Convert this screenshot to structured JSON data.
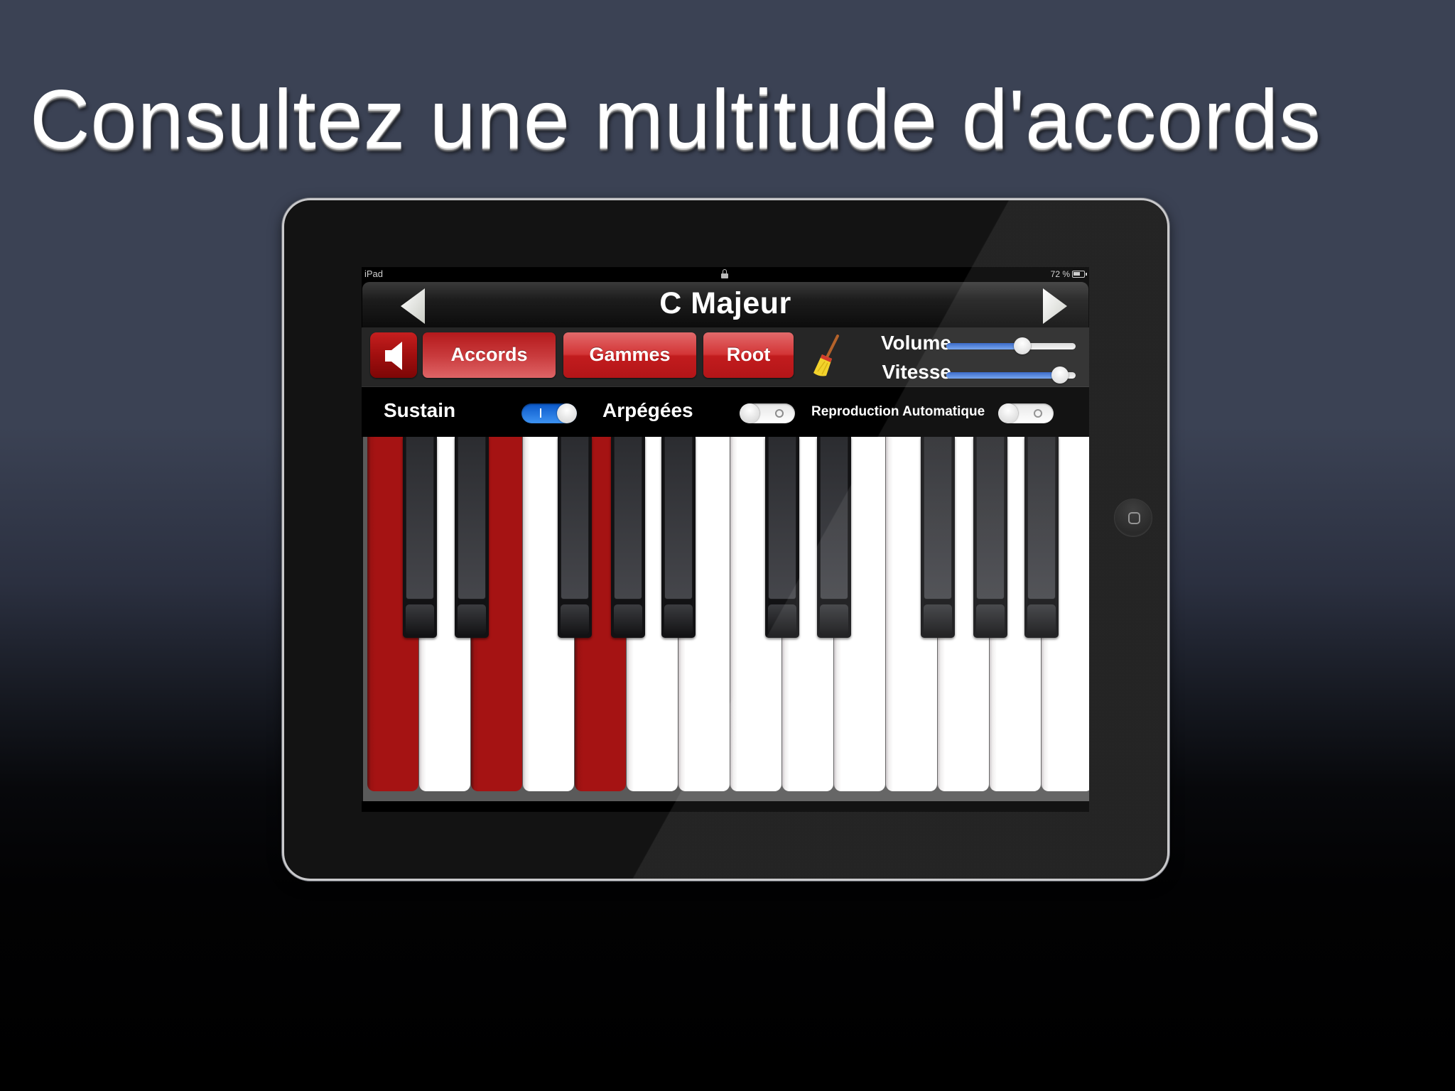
{
  "headline": "Consultez une multitude d'accords",
  "status_bar": {
    "carrier": "iPad",
    "battery_percent": "72 %",
    "battery_level": 0.72,
    "lock_icon": "lock-icon"
  },
  "nav": {
    "title": "C Majeur",
    "prev_icon": "triangle-left-icon",
    "next_icon": "triangle-right-icon"
  },
  "toolbar": {
    "speaker_icon": "speaker-icon",
    "buttons": [
      {
        "label": "Accords",
        "active": true
      },
      {
        "label": "Gammes",
        "active": false
      },
      {
        "label": "Root",
        "active": false
      }
    ],
    "clear_icon": "broom-icon",
    "volume": {
      "label": "Volume",
      "value": 0.59
    },
    "vitesse": {
      "label": "Vitesse",
      "value": 0.88
    }
  },
  "toggles": [
    {
      "label": "Sustain",
      "on": true
    },
    {
      "label": "Arpégées",
      "on": false
    },
    {
      "label": "Reproduction Automatique",
      "on": false
    }
  ],
  "keyboard": {
    "white_keys": [
      "C",
      "D",
      "E",
      "F",
      "G",
      "A",
      "B",
      "C",
      "D",
      "E",
      "F",
      "G",
      "A",
      "B"
    ],
    "black_keys": [
      "C#",
      "D#",
      "F#",
      "G#",
      "A#",
      "C#",
      "D#",
      "F#",
      "G#",
      "A#"
    ],
    "highlighted": [
      "C",
      "E",
      "G"
    ],
    "highlight_color": "#a51313"
  },
  "colors": {
    "accent_red": "#c8393b",
    "switch_blue": "#3d93f3",
    "background": "#3b4254"
  }
}
